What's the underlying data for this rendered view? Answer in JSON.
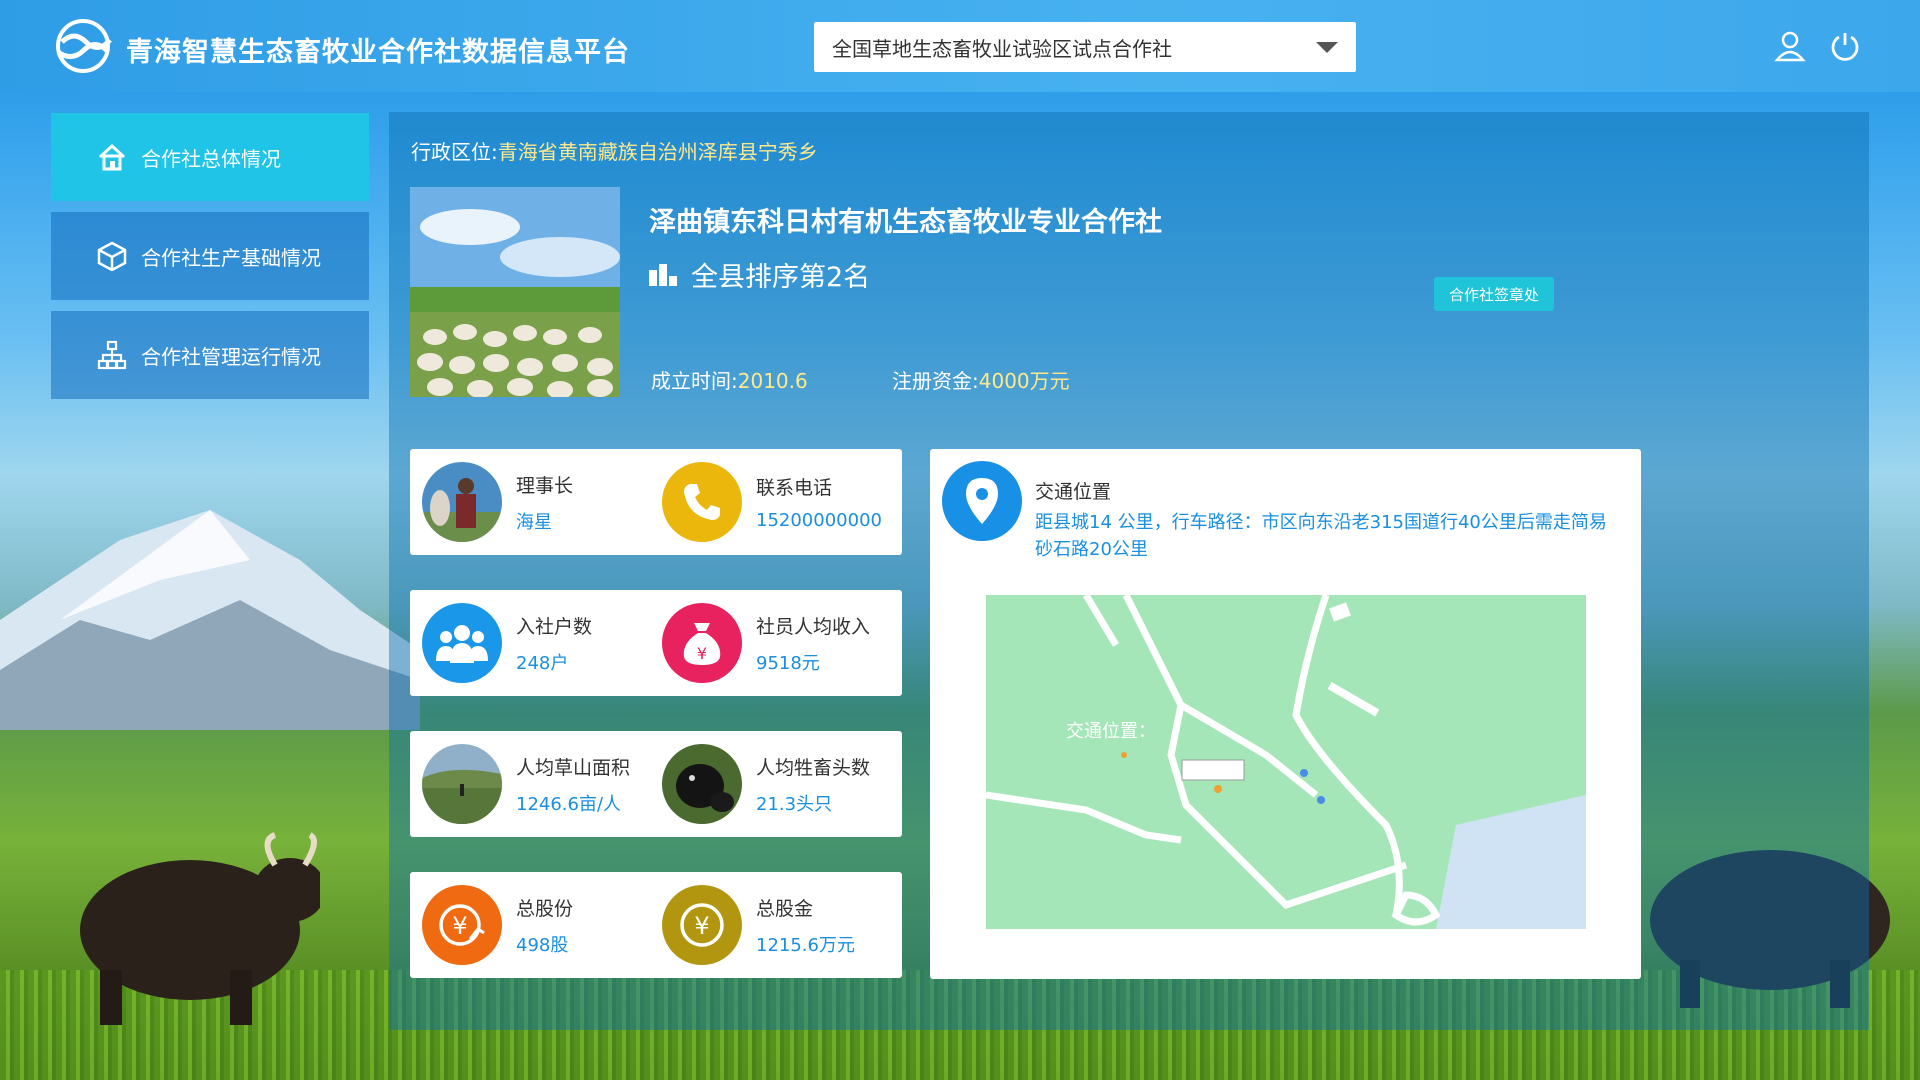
{
  "header": {
    "app_title": "青海智慧生态畜牧业合作社数据信息平台",
    "coop_select_value": "全国草地生态畜牧业试验区试点合作社"
  },
  "sidebar": {
    "items": [
      {
        "label": "合作社总体情况",
        "icon": "home-icon",
        "active": true
      },
      {
        "label": "合作社生产基础情况",
        "icon": "cube-icon",
        "active": false
      },
      {
        "label": "合作社管理运行情况",
        "icon": "org-chart-icon",
        "active": false
      }
    ]
  },
  "overview": {
    "admin_region_label": "行政区位:",
    "admin_region_value": "青海省黄南藏族自治州泽库县宁秀乡",
    "coop_name": "泽曲镇东科日村有机生态畜牧业专业合作社",
    "rank_text": "全县排序第2名",
    "stamp_button": "合作社签章处",
    "founded_label": "成立时间:",
    "founded_value": "2010.6",
    "capital_label": "注册资金:",
    "capital_value": "4000万元"
  },
  "stats": {
    "chairman": {
      "label": "理事长",
      "value": "海星"
    },
    "phone": {
      "label": "联系电话",
      "value": "15200000000"
    },
    "households": {
      "label": "入社户数",
      "value": "248户"
    },
    "income": {
      "label": "社员人均收入",
      "value": "9518元"
    },
    "grassland": {
      "label": "人均草山面积",
      "value": "1246.6亩/人"
    },
    "livestock": {
      "label": "人均牲畜头数",
      "value": "21.3头只"
    },
    "shares": {
      "label": "总股份",
      "value": "498股"
    },
    "capital": {
      "label": "总股金",
      "value": "1215.6万元"
    }
  },
  "traffic": {
    "title": "交通位置",
    "description": "距县城14 公里，行车路径：市区向东沿老315国道行40公里后需走简易砂石路20公里",
    "map_overlay_label": "交通位置："
  },
  "colors": {
    "accent": "#1fc4e6",
    "blue_value": "#1a8fe0",
    "yellow_value": "#ffe98a"
  }
}
